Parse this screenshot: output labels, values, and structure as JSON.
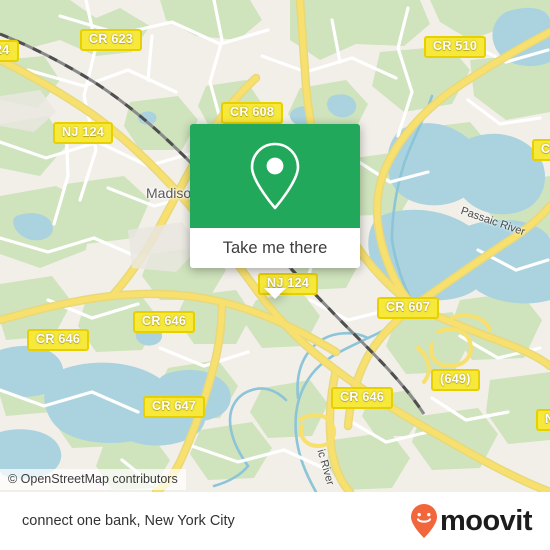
{
  "map": {
    "provider_attribution": "© OpenStreetMap contributors",
    "colors": {
      "land": "#f2efe9",
      "park_green": "#cfe3bd",
      "water_blue": "#aad3df",
      "road_major": "#f7e06e",
      "road_minor": "#ffffff",
      "rail": "#707070",
      "shield_yellow": "#f7e93b"
    },
    "place_labels": [
      {
        "name": "Madison",
        "text": "Madison"
      }
    ],
    "feature_labels": [
      {
        "name": "passaic-river-upper",
        "text": "Passaic River"
      },
      {
        "name": "passaic-river-lower",
        "text": "ic River"
      }
    ],
    "road_shields": [
      {
        "name": "route-shield-nj-124-edge",
        "text": "24"
      },
      {
        "name": "route-shield-cr-623",
        "text": "CR 623"
      },
      {
        "name": "route-shield-cr-510",
        "text": "CR 510"
      },
      {
        "name": "route-shield-cr-608",
        "text": "CR 608"
      },
      {
        "name": "route-shield-nj-124-west",
        "text": "NJ 124"
      },
      {
        "name": "route-shield-cr-right-edge",
        "text": "CR"
      },
      {
        "name": "route-shield-nj-124-center",
        "text": "NJ 124"
      },
      {
        "name": "route-shield-cr-607",
        "text": "CR 607"
      },
      {
        "name": "route-shield-cr-646-center",
        "text": "CR 646"
      },
      {
        "name": "route-shield-cr-646-west",
        "text": "CR 646"
      },
      {
        "name": "route-shield-cr-646-south",
        "text": "CR 646"
      },
      {
        "name": "route-shield-cr-647",
        "text": "CR 647"
      },
      {
        "name": "route-shield-649",
        "text": "(649)"
      },
      {
        "name": "route-shield-n-right-edge",
        "text": "N"
      }
    ]
  },
  "callout": {
    "pin_icon": "map-pin-icon",
    "button_label": "Take me there",
    "accent_color": "#21a85a"
  },
  "footer": {
    "caption": "connect one bank, New York City",
    "brand_name": "moovit",
    "brand_pin_color": "#f2663c",
    "brand_icon": "moovit-smiley-pin-icon"
  }
}
